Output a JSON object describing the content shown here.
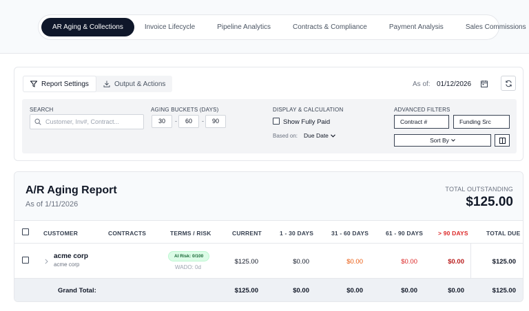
{
  "nav": {
    "tabs": [
      {
        "label": "AR Aging & Collections",
        "active": true
      },
      {
        "label": "Invoice Lifecycle"
      },
      {
        "label": "Pipeline Analytics"
      },
      {
        "label": "Contracts & Compliance"
      },
      {
        "label": "Payment Analysis"
      },
      {
        "label": "Sales Commissions"
      }
    ]
  },
  "settings": {
    "report_settings_label": "Report Settings",
    "output_actions_label": "Output & Actions",
    "as_of_label": "As of:",
    "as_of_value": "01/12/2026",
    "search": {
      "label": "SEARCH",
      "placeholder": "Customer, Inv#, Contract...",
      "value": ""
    },
    "aging_buckets": {
      "label": "AGING BUCKETS (DAYS)",
      "b1": "30",
      "b2": "60",
      "b3": "90",
      "separator": "-"
    },
    "display": {
      "label": "DISPLAY & CALCULATION",
      "show_fully_paid": "Show Fully Paid",
      "show_fully_paid_checked": false,
      "based_on_label": "Based on:",
      "based_on_value": "Due Date"
    },
    "advanced": {
      "label": "ADVANCED FILTERS",
      "contract": "Contract #",
      "funding": "Funding Src",
      "sort_by": "Sort By"
    }
  },
  "report": {
    "title": "A/R Aging Report",
    "subtitle": "As of 1/11/2026",
    "total_label": "TOTAL OUTSTANDING",
    "total_value": "$125.00",
    "columns": {
      "customer": "CUSTOMER",
      "contracts": "CONTRACTS",
      "terms_risk": "TERMS / RISK",
      "current": "CURRENT",
      "d1_30": "1 - 30 DAYS",
      "d31_60": "31 - 60 DAYS",
      "d61_90": "61 - 90 DAYS",
      "d90_plus": "> 90 DAYS",
      "total_due": "TOTAL DUE"
    },
    "rows": [
      {
        "customer": "acme corp",
        "customer_sub": "acme corp",
        "contracts": "",
        "risk": "AI Risk: 0/100",
        "wado": "WADO: 0d",
        "current": "$125.00",
        "d1_30": "$0.00",
        "d31_60": "$0.00",
        "d61_90": "$0.00",
        "d90_plus": "$0.00",
        "total_due": "$125.00"
      }
    ],
    "grand_total": {
      "label": "Grand Total:",
      "current": "$125.00",
      "d1_30": "$0.00",
      "d31_60": "$0.00",
      "d61_90": "$0.00",
      "d90_plus": "$0.00",
      "total_due": "$125.00"
    }
  },
  "colors": {
    "nav_active_bg": "#0f172a",
    "orange": "#ea580c",
    "red": "#dc2626",
    "risk_badge_bg": "#dcfce7",
    "risk_badge_text": "#166534"
  },
  "icons": {
    "filter": "filter-icon",
    "download": "download-icon",
    "calendar": "calendar-icon",
    "refresh": "refresh-icon",
    "search": "search-icon",
    "chevron": "chevron-down-icon",
    "expand": "chevron-right-icon",
    "columns": "columns-icon"
  }
}
